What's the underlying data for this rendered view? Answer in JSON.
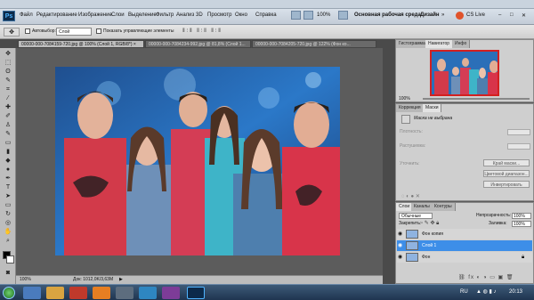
{
  "app": {
    "logo": "Ps",
    "zoom": "100%",
    "workspace": "Основная рабочая среда",
    "design": "Дизайн",
    "cslive": "CS Live"
  },
  "menu": [
    "Файл",
    "Редактирование",
    "Изображение",
    "Слои",
    "Выделение",
    "Фильтр",
    "Анализ",
    "3D",
    "Просмотр",
    "Окно",
    "Справка"
  ],
  "options": {
    "autoselect": "Автовыбор:",
    "layer": "Слой",
    "show_controls": "Показать управляющие элементы"
  },
  "tabs": [
    "00000-000-7084159-720.jpg @ 100% (Слой 1, RGB/8*) ×",
    "00000-000-7084234-992.jpg @ 81,8% (Слой 1...",
    "00000-000-7084205-720.jpg @ 122% (Фон ко..."
  ],
  "status": {
    "zoom": "100%",
    "doc": "Док: 1012,0K/3,63M"
  },
  "navigator": {
    "tabs": [
      "Гистограмма",
      "Навигатор",
      "Инфо"
    ],
    "zoom": "100%"
  },
  "masks": {
    "tabs": [
      "Коррекция",
      "Маски"
    ],
    "title": "Маска не выбрана",
    "density": "Плотность:",
    "feather": "Растушевка:",
    "refine": "Уточнить:",
    "btn_edge": "Край маски...",
    "btn_color": "Цветовой диапазон...",
    "btn_invert": "Инвертировать"
  },
  "layers": {
    "tabs": [
      "Слои",
      "Каналы",
      "Контуры"
    ],
    "blend": "Обычные",
    "opacity_label": "Непрозрачность:",
    "opacity": "100%",
    "lock_label": "Закрепить:",
    "fill_label": "Заливка:",
    "fill": "100%",
    "items": [
      {
        "name": "Фон копия",
        "selected": false
      },
      {
        "name": "Слой 1",
        "selected": true
      },
      {
        "name": "Фон",
        "selected": false
      }
    ]
  },
  "taskbar": {
    "lang": "RU",
    "time": "20:13"
  },
  "colors": {
    "accent": "#3a8ee6",
    "taskbar": "#1f3550",
    "selected_layer": "#3d8ee8"
  }
}
